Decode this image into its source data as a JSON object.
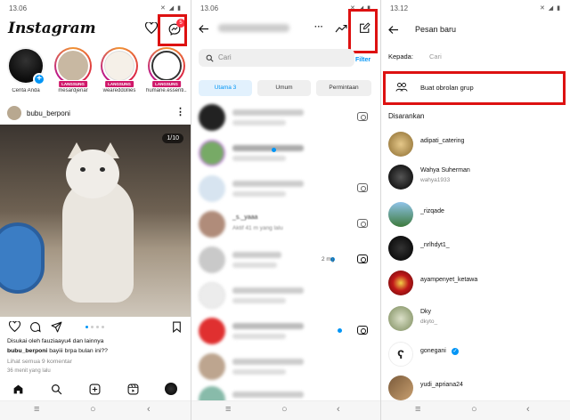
{
  "panel1": {
    "status_time": "13.06",
    "status_icons": "✕ ◢ ▮ ",
    "app_title": "Instagram",
    "messenger_badge": "5",
    "stories": [
      {
        "name": "Cerita Anda",
        "live": ""
      },
      {
        "name": "mesardjenar",
        "live": "LANGSUNG"
      },
      {
        "name": "weareddollies",
        "live": "LANGSUNG"
      },
      {
        "name": "humane.essenti...",
        "live": "LANGSUNG"
      }
    ],
    "post_user": "bubu_berponi",
    "photo_counter": "1/10",
    "likes_text": "Disukai oleh fauziaayu4 dan lainnya",
    "caption_user": "bubu_berponi",
    "caption_text": " bayiii brpa bulan ini??",
    "comments_link": "Lihat semua 9 komentar",
    "time_ago": "36 menit yang lalu"
  },
  "panel2": {
    "status_time": "13.06",
    "search_placeholder": "Cari",
    "filter_label": "Filter",
    "chips": [
      "Utama 3",
      "Umum",
      "Permintaan"
    ],
    "row_text_1": "_s._yaaa",
    "row_text_2": "Aktif 41 m yang lalu",
    "row_time": "2 mg"
  },
  "panel3": {
    "status_time": "13.12",
    "title": "Pesan baru",
    "to_label": "Kepada:",
    "search_placeholder": "Cari",
    "create_group": "Buat obrolan grup",
    "suggested_label": "Disarankan",
    "suggestions": [
      {
        "name": "adipati_catering",
        "sub": ""
      },
      {
        "name": "Wahya Suherman",
        "sub": "wahya1933"
      },
      {
        "name": "_rizqade",
        "sub": ""
      },
      {
        "name": "_nrlhdyt1_",
        "sub": ""
      },
      {
        "name": "ayampenyet_ketawa",
        "sub": ""
      },
      {
        "name": "Dky",
        "sub": "dkyto_"
      },
      {
        "name": "gonegani",
        "sub": ""
      },
      {
        "name": "yudi_apriana24",
        "sub": ""
      }
    ]
  },
  "colors": {
    "accent": "#0095f6",
    "highlight": "#d11111",
    "live": "#d0186a"
  }
}
